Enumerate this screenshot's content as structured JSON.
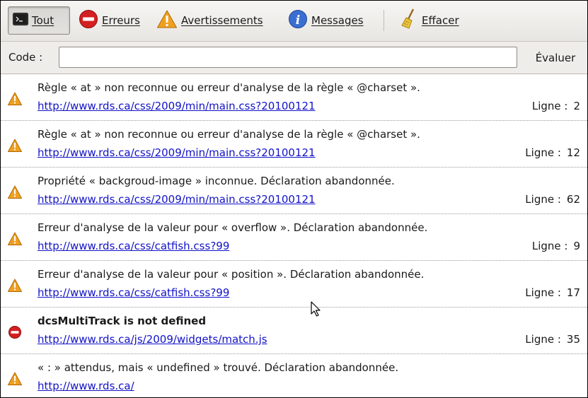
{
  "toolbar": {
    "all_label": "Tout",
    "errors_label": "Erreurs",
    "warnings_label": "Avertissements",
    "messages_label": "Messages",
    "clear_label": "Effacer"
  },
  "code_bar": {
    "label": "Code :",
    "input_value": "",
    "evaluate_label": "Évaluer"
  },
  "messages": [
    {
      "type": "warning",
      "text": "Règle « at » non reconnue ou erreur d'analyse de la règle « @charset ».",
      "url": "http://www.rds.ca/css/2009/min/main.css?20100121",
      "line_label": "Ligne :",
      "line": "2"
    },
    {
      "type": "warning",
      "text": "Règle « at » non reconnue ou erreur d'analyse de la règle « @charset ».",
      "url": "http://www.rds.ca/css/2009/min/main.css?20100121",
      "line_label": "Ligne :",
      "line": "12"
    },
    {
      "type": "warning",
      "text": "Propriété « backgroud-image » inconnue.  Déclaration abandonnée.",
      "url": "http://www.rds.ca/css/2009/min/main.css?20100121",
      "line_label": "Ligne :",
      "line": "62"
    },
    {
      "type": "warning",
      "text": "Erreur d'analyse de la valeur pour « overflow ».  Déclaration abandonnée.",
      "url": "http://www.rds.ca/css/catfish.css?99",
      "line_label": "Ligne :",
      "line": "9"
    },
    {
      "type": "warning",
      "text": "Erreur d'analyse de la valeur pour « position ».  Déclaration abandonnée.",
      "url": "http://www.rds.ca/css/catfish.css?99",
      "line_label": "Ligne :",
      "line": "17"
    },
    {
      "type": "error",
      "text": "dcsMultiTrack is not defined",
      "url": "http://www.rds.ca/js/2009/widgets/match.js",
      "line_label": "Ligne :",
      "line": "35"
    },
    {
      "type": "warning",
      "text": "« : » attendus, mais « undefined » trouvé.  Déclaration abandonnée.",
      "url": "http://www.rds.ca/",
      "line_label": "",
      "line": ""
    }
  ],
  "colors": {
    "link": "#1212c8",
    "warning": "#f0a020",
    "error": "#d42020",
    "info": "#3a6fd0"
  }
}
